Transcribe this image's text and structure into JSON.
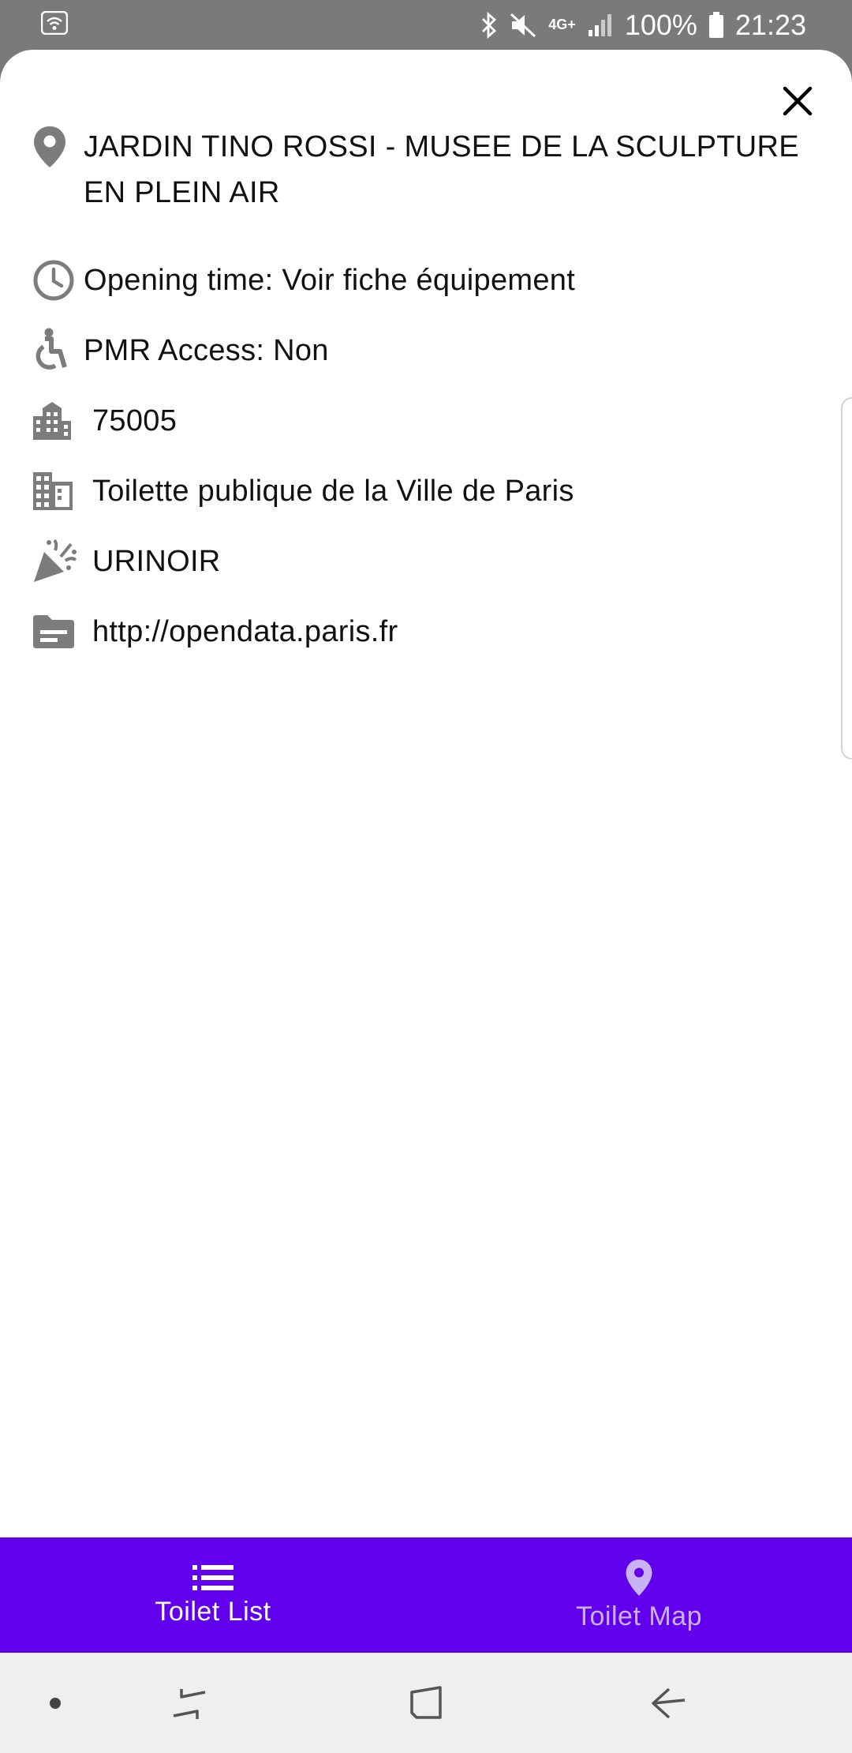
{
  "status_bar": {
    "battery": "100%",
    "time": "21:23",
    "network": "4G+"
  },
  "details": {
    "name": "JARDIN TINO ROSSI - MUSEE DE LA SCULPTURE EN PLEIN AIR",
    "opening_time": "Opening time: Voir fiche équipement",
    "pmr_access": "PMR Access: Non",
    "postal_code": "75005",
    "manager": "Toilette publique de la Ville de Paris",
    "type": "URINOIR",
    "source": "http://opendata.paris.fr"
  },
  "icons": {
    "close": "close-icon",
    "place": "location-pin-icon",
    "clock": "clock-icon",
    "accessible": "wheelchair-icon",
    "city": "city-buildings-icon",
    "business": "building-icon",
    "celebration": "party-popper-icon",
    "source": "document-icon",
    "list": "list-icon",
    "map": "map-pin-icon"
  },
  "bottom_nav": {
    "items": [
      {
        "label": "Toilet List",
        "active": true
      },
      {
        "label": "Toilet Map",
        "active": false
      }
    ]
  },
  "colors": {
    "primary": "#6200ee",
    "icon_gray": "#7c7c7c",
    "status_bar": "#7a7a7a"
  }
}
